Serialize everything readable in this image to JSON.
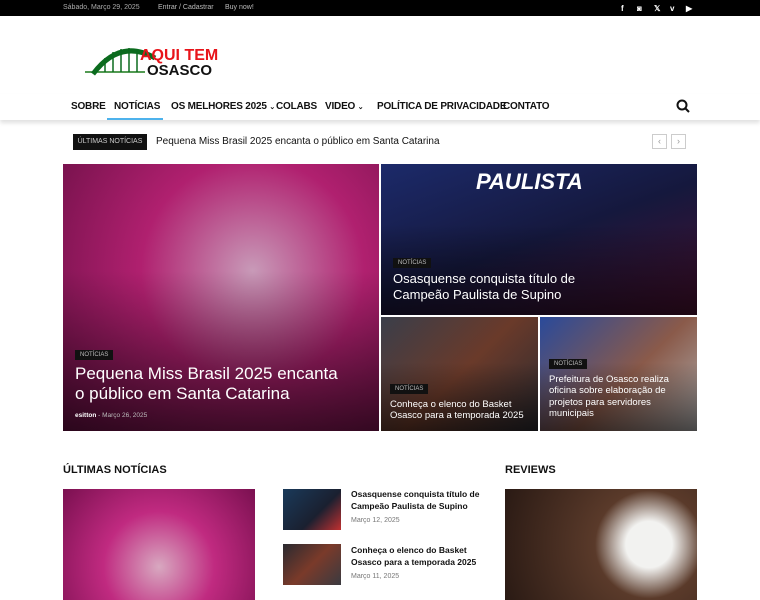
{
  "topbar": {
    "date": "Sábado, Março 29, 2025",
    "login": "Entrar / Cadastrar",
    "buy": "Buy now!",
    "social": [
      "facebook-icon",
      "instagram-icon",
      "x-icon",
      "vimeo-icon",
      "youtube-icon"
    ]
  },
  "logo": {
    "line1": "AQUI TEM",
    "line2": "OSASCO"
  },
  "nav": {
    "items": [
      "SOBRE",
      "NOTÍCIAS",
      "OS MELHORES 2025",
      "COLABS",
      "VIDEO",
      "POLÍTICA DE PRIVACIDADE",
      "CONTATO"
    ],
    "active": "NOTÍCIAS"
  },
  "ticker": {
    "label": "ÚLTIMAS NOTÍCIAS",
    "headline": "Pequena Miss Brasil 2025 encanta o público em Santa Catarina",
    "prev": "‹",
    "next": "›"
  },
  "featured": [
    {
      "category": "NOTÍCIAS",
      "title": "Pequena Miss Brasil 2025 encanta o público em Santa Catarina",
      "author": "esitton",
      "date": "Março 26, 2025"
    },
    {
      "category": "NOTÍCIAS",
      "title": "Osasquense conquista título de Campeão Paulista de Supino"
    },
    {
      "category": "NOTÍCIAS",
      "title": "Conheça o elenco do Basket Osasco para a temporada 2025"
    },
    {
      "category": "NOTÍCIAS",
      "title": "Prefeitura de Osasco realiza oficina sobre elaboração de projetos para servidores municipais"
    }
  ],
  "sections": {
    "latest": "ÚLTIMAS NOTÍCIAS",
    "reviews": "REVIEWS"
  },
  "latest_list": [
    {
      "title": "Osasquense conquista título de Campeão Paulista de Supino",
      "date": "Março 12, 2025"
    },
    {
      "title": "Conheça o elenco do Basket Osasco para a temporada 2025",
      "date": "Março 11, 2025"
    }
  ]
}
